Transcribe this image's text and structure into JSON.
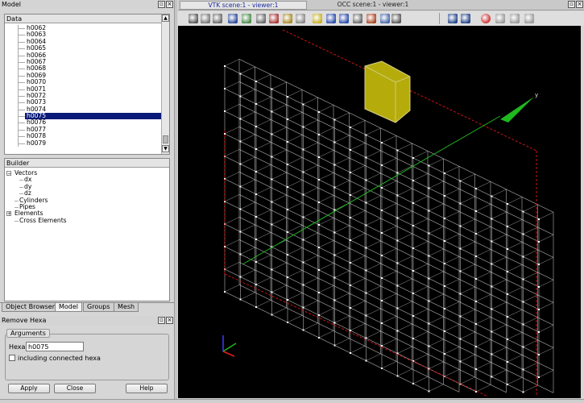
{
  "left_panel": {
    "title": "Model",
    "data_header": "Data",
    "data_items": [
      "h0062",
      "h0063",
      "h0064",
      "h0065",
      "h0066",
      "h0067",
      "h0068",
      "h0069",
      "h0070",
      "h0071",
      "h0072",
      "h0073",
      "h0074",
      "h0075",
      "h0076",
      "h0077",
      "h0078",
      "h0079"
    ],
    "selected_item": "h0075",
    "builder_header": "Builder",
    "builder_items": [
      {
        "label": "Vectors",
        "indent": 0,
        "expander": "−"
      },
      {
        "label": "dx",
        "indent": 2,
        "expander": ""
      },
      {
        "label": "dy",
        "indent": 2,
        "expander": ""
      },
      {
        "label": "dz",
        "indent": 2,
        "expander": ""
      },
      {
        "label": "Cylinders",
        "indent": 1,
        "expander": ""
      },
      {
        "label": "Pipes",
        "indent": 1,
        "expander": ""
      },
      {
        "label": "Elements",
        "indent": 0,
        "expander": "+"
      },
      {
        "label": "Cross Elements",
        "indent": 1,
        "expander": ""
      }
    ],
    "tabs": [
      "Object Browser",
      "Model",
      "Groups",
      "Mesh"
    ],
    "active_tab": "Model"
  },
  "remove_panel": {
    "title": "Remove Hexa",
    "group_label": "Arguments",
    "hexa_label": "Hexa",
    "hexa_value": "h0075",
    "checkbox_label": "including connected hexa",
    "checkbox_checked": false,
    "apply_label": "Apply",
    "close_label": "Close",
    "help_label": "Help"
  },
  "viewer": {
    "tab_vtk": "VTK scene:1 - viewer:1",
    "tab_occ": "OCC scene:1 - viewer:1",
    "axis_label": "y",
    "background": "#000000"
  },
  "colors": {
    "selection": "#0a1a78",
    "hexa_highlight": "#b5ac0c",
    "axis_green": "#1fb81f",
    "edge_red": "#c81414",
    "mesh_white": "#e6e6e6"
  }
}
